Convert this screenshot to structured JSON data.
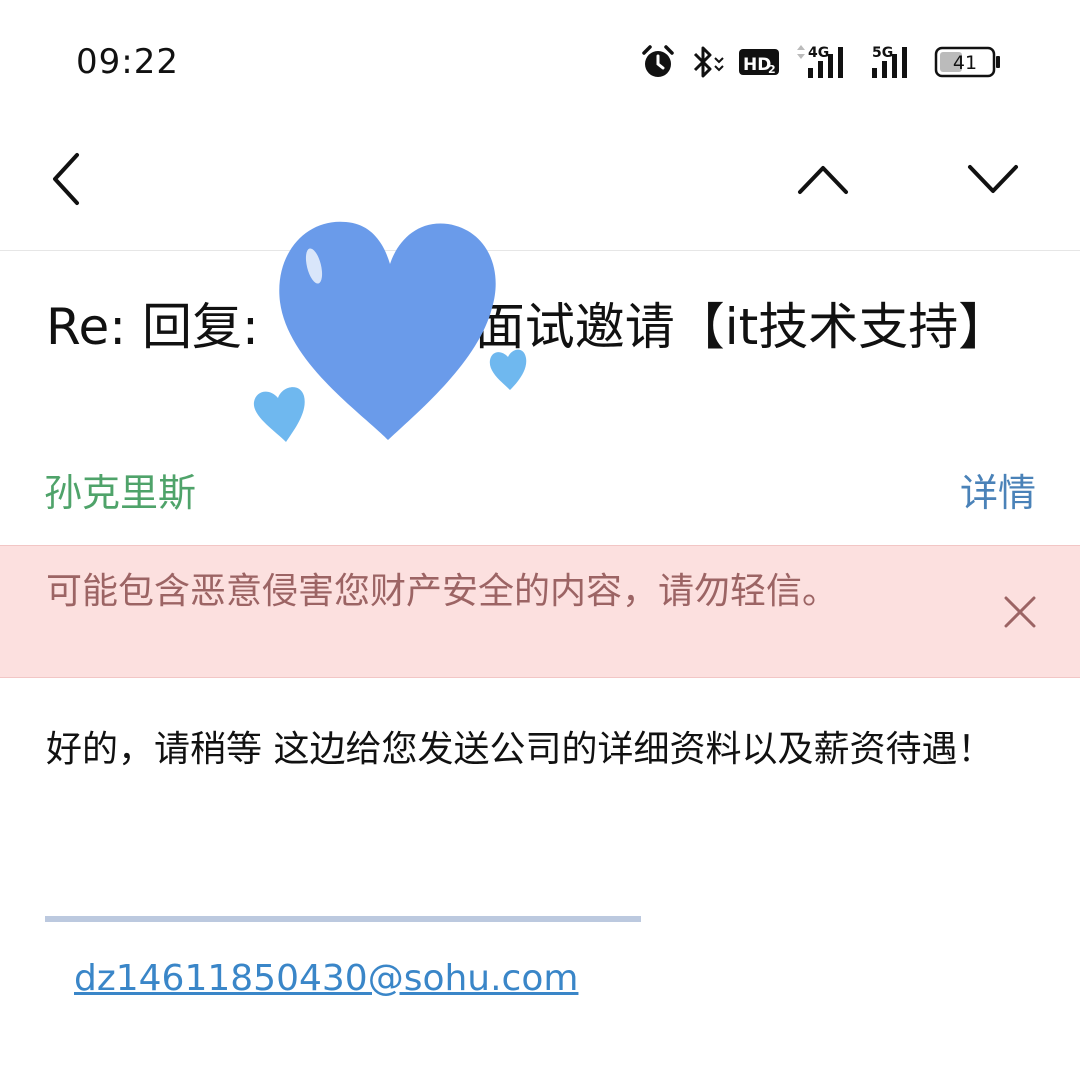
{
  "status_bar": {
    "time": "09:22",
    "hd_label": "HD",
    "net1_label": "4G",
    "net2_label": "5G",
    "battery": "41",
    "icons": [
      "alarm-icon",
      "bluetooth-icon",
      "hd-call-icon",
      "signal-4g-icon",
      "signal-5g-icon",
      "battery-icon"
    ]
  },
  "toolbar": {
    "icons": [
      "back-arrow-icon",
      "previous-mail-icon",
      "next-mail-icon"
    ]
  },
  "email": {
    "subject": "Re: 回复: 　　　　面试邀请【it技术支持】",
    "sender": "孙克里斯",
    "details_label": "详情",
    "warning": "可能包含恶意侵害您财产安全的内容，请勿轻信。",
    "body": "好的，请稍等 这边给您发送公司的详细资料以及薪资待遇！",
    "signature_email": "dz14611850430@sohu.com"
  },
  "colors": {
    "sender": "#4fa36a",
    "details": "#4a82b8",
    "warning_bg": "#fce0df",
    "warning_text": "#9c6464",
    "link": "#3a86c8",
    "sticker": "#6a9bea"
  }
}
